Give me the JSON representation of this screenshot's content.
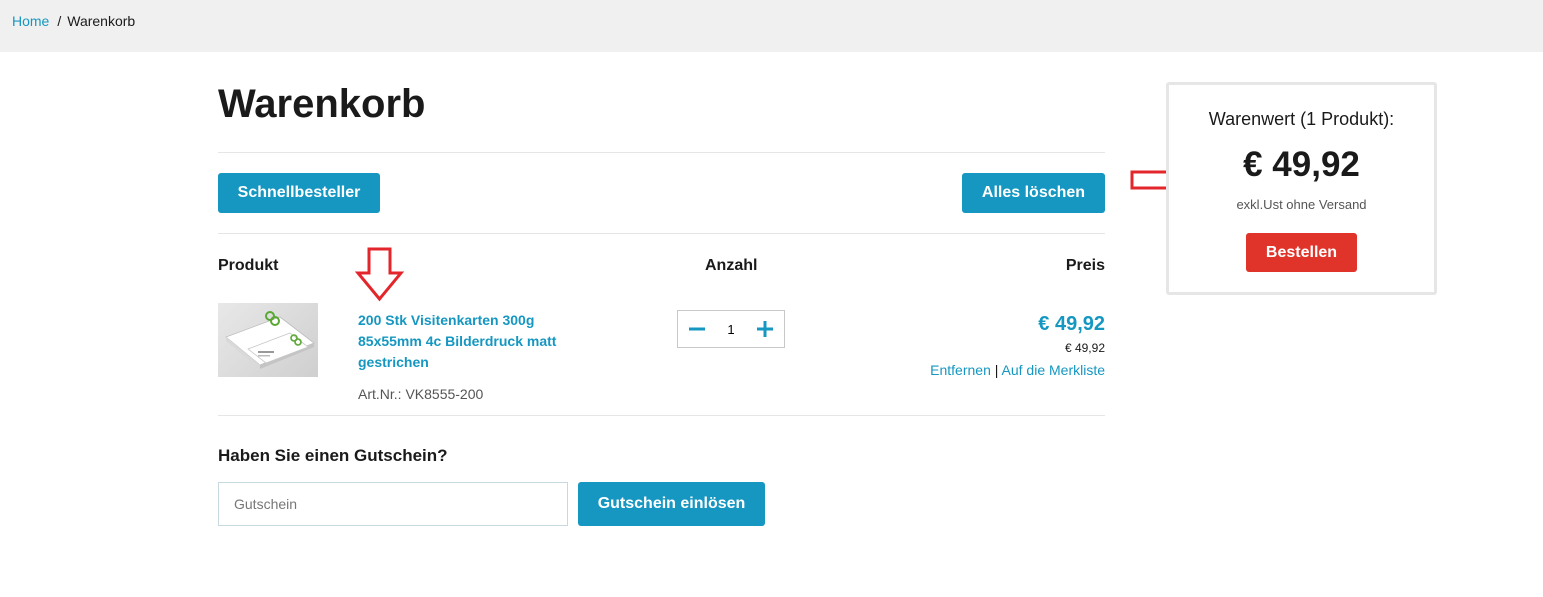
{
  "breadcrumb": {
    "home": "Home",
    "separator": "/",
    "current": "Warenkorb"
  },
  "page": {
    "title": "Warenkorb"
  },
  "toolbar": {
    "quick_order": "Schnellbesteller",
    "clear_all": "Alles löschen"
  },
  "cart": {
    "columns": {
      "product": "Produkt",
      "quantity": "Anzahl",
      "price": "Preis"
    },
    "items": [
      {
        "name": "200 Stk Visitenkarten 300g 85x55mm 4c Bilderdruck matt gestrichen",
        "art_nr": "Art.Nr.: VK8555-200",
        "quantity": "1",
        "price": "€ 49,92",
        "unit_price": "€ 49,92",
        "remove": "Entfernen",
        "link_separator": "|",
        "wishlist": "Auf die Merkliste"
      }
    ]
  },
  "coupon": {
    "question": "Haben Sie einen Gutschein?",
    "placeholder": "Gutschein",
    "redeem": "Gutschein einlösen"
  },
  "summary": {
    "title": "Warenwert (1 Produkt):",
    "total": "€ 49,92",
    "note": "exkl.Ust ohne Versand",
    "order": "Bestellen"
  },
  "colors": {
    "accent": "#1597c1",
    "order_button": "#e0342b",
    "annotation_arrow": "#e3262b"
  },
  "icons": {
    "quantity_decrease": "minus-icon",
    "quantity_increase": "plus-icon",
    "annotation": "red-arrow-icon"
  }
}
